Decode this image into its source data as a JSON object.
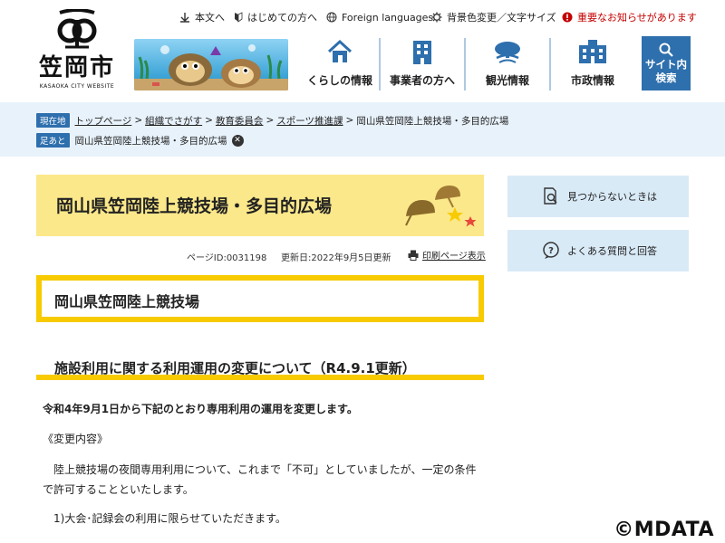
{
  "header": {
    "logo_name": "笠岡市",
    "logo_en": "KASAOKA CITY WEBSITE",
    "utility": [
      {
        "name": "text-only-link",
        "label": "本文へ"
      },
      {
        "name": "first-visit-link",
        "label": "はじめての方へ"
      },
      {
        "name": "foreign-languages-link",
        "label": "Foreign languages"
      },
      {
        "name": "color-text-size-link",
        "label": "背景色変更／文字サイズ"
      },
      {
        "name": "important-notice-link",
        "label": "重要なお知らせがあります"
      }
    ],
    "nav": [
      {
        "label": "くらしの情報",
        "icon": "house-icon"
      },
      {
        "label": "事業者の方へ",
        "icon": "office-building-icon"
      },
      {
        "label": "観光情報",
        "icon": "tourism-icon"
      },
      {
        "label": "市政情報",
        "icon": "city-hall-icon"
      }
    ],
    "search_label_1": "サイト内",
    "search_label_2": "検索"
  },
  "breadcrumb": {
    "tag": "現在地",
    "items": [
      "トップページ",
      "組織でさがす",
      "教育委員会",
      "スポーツ推進課"
    ],
    "current": "岡山県笠岡陸上競技場・多目的広場",
    "separator": ">"
  },
  "footprints": {
    "tag": "足あと",
    "item": "岡山県笠岡陸上競技場・多目的広場"
  },
  "page": {
    "title": "岡山県笠岡陸上競技場・多目的広場",
    "page_id": "ページID:0031198",
    "updated": "更新日:2022年9月5日更新",
    "print_label": "印刷ページ表示",
    "h2": "岡山県笠岡陸上競技場",
    "h3": "施設利用に関する利用運用の変更について（R4.9.1更新）",
    "paragraphs": [
      "令和4年9月1日から下記のとおり専用利用の運用を変更します。",
      "《変更内容》",
      "陸上競技場の夜間専用利用について、これまで「不可」としていましたが、一定の条件で許可することといたします。",
      "1)大会･記録会の利用に限らせていただきます。"
    ]
  },
  "sidebar": {
    "not_found": "見つからないときは",
    "faq": "よくある質問と回答"
  },
  "copyright": "©MDATA",
  "colors": {
    "primary_blue": "#2e6fad",
    "band_bg": "#e8f2fb",
    "title_bg": "#fbe88a",
    "accent_yellow": "#f7cb00",
    "sidebar_bg": "#d9eaf7",
    "alert_red": "#c40000"
  }
}
